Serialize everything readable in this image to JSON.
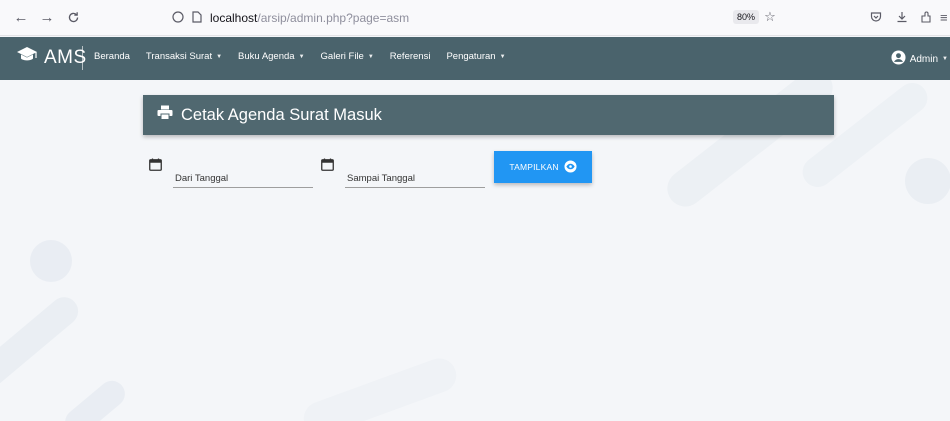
{
  "browser": {
    "url_host": "localhost",
    "url_path": "/arsip/admin.php?page=asm",
    "zoom": "80%",
    "icons": [
      "back-icon",
      "forward-icon",
      "reload-icon",
      "shield-icon",
      "page-icon",
      "star-icon",
      "pocket-icon",
      "download-icon",
      "extensions-icon",
      "menu-icon"
    ]
  },
  "navbar": {
    "brand": "AMS",
    "items": [
      {
        "label": "Beranda",
        "dropdown": false
      },
      {
        "label": "Transaksi Surat",
        "dropdown": true
      },
      {
        "label": "Buku Agenda",
        "dropdown": true
      },
      {
        "label": "Galeri File",
        "dropdown": true
      },
      {
        "label": "Referensi",
        "dropdown": false
      },
      {
        "label": "Pengaturan",
        "dropdown": true
      }
    ],
    "user": "Admin"
  },
  "card": {
    "title": "Cetak Agenda Surat Masuk"
  },
  "form": {
    "from_placeholder": "Dari Tanggal",
    "to_placeholder": "Sampai Tanggal",
    "submit_label": "TAMPILKAN"
  },
  "colors": {
    "navbar": "#4a636c",
    "card_header": "#506870",
    "button": "#2196f3"
  }
}
